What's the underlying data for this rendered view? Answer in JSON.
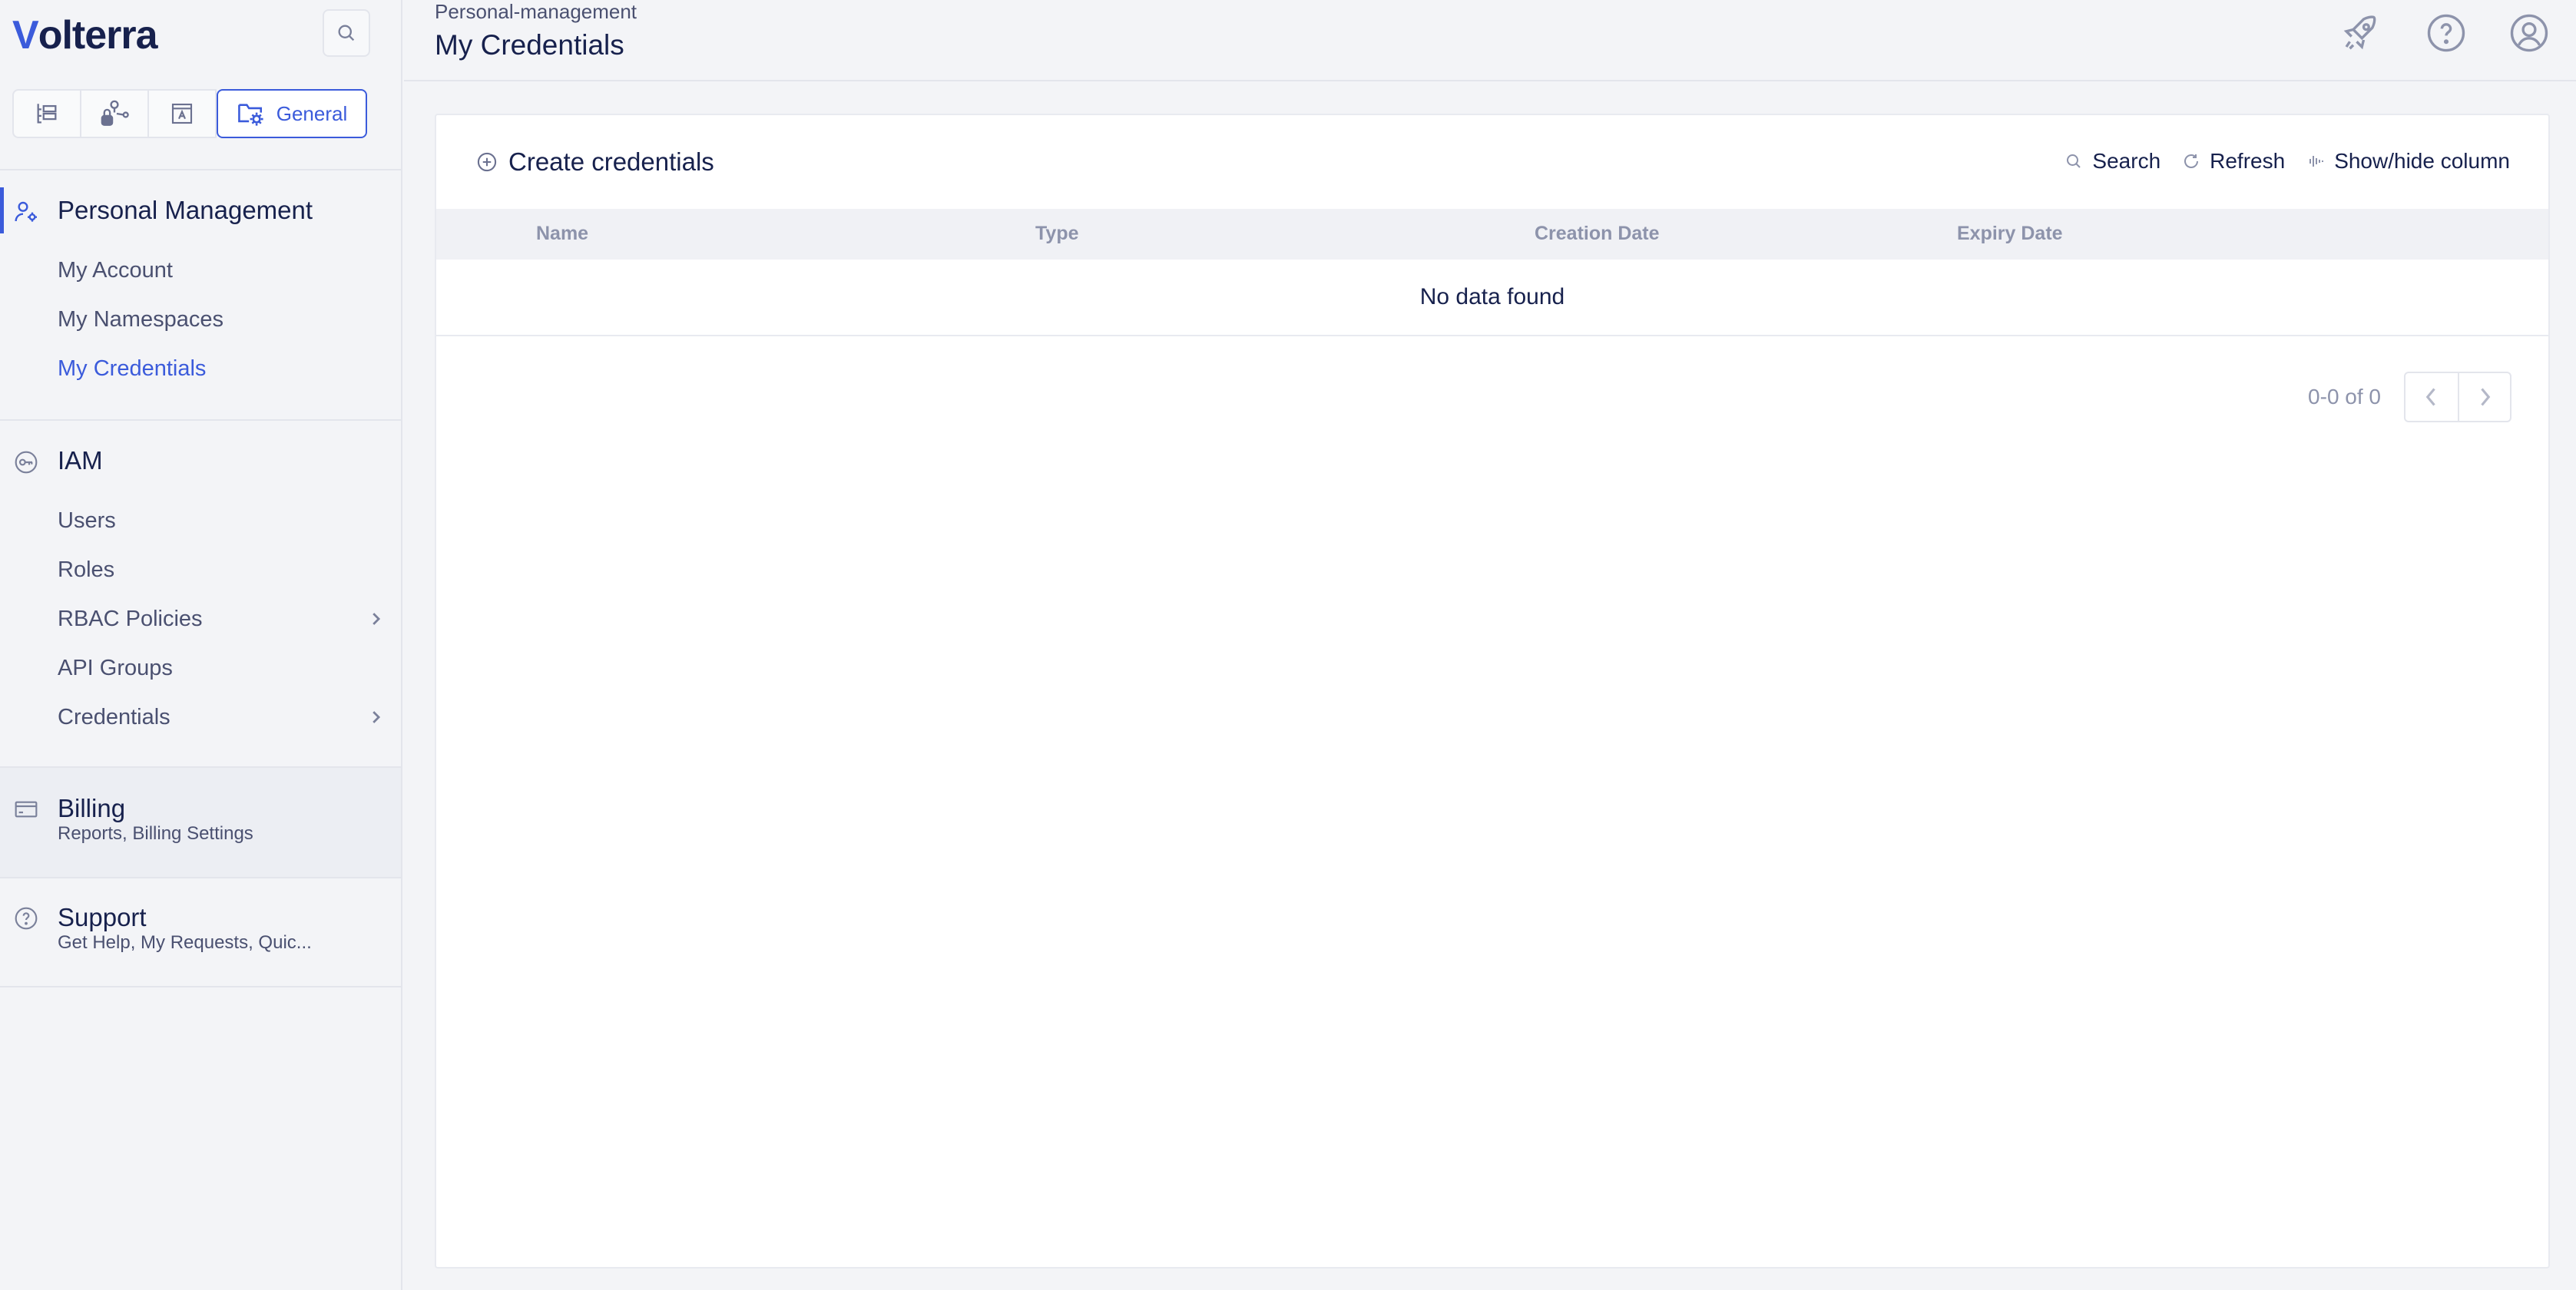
{
  "app": {
    "logo_text_v": "V",
    "logo_text_rest": "olterra"
  },
  "sidebar": {
    "tabs": [
      {
        "icon": "hierarchy-icon"
      },
      {
        "icon": "network-lock-icon"
      },
      {
        "icon": "app-window-icon"
      },
      {
        "icon": "folder-gear-icon",
        "label": "General"
      }
    ],
    "personal_management": {
      "title": "Personal Management",
      "items": [
        "My Account",
        "My Namespaces",
        "My Credentials"
      ],
      "selected": "My Credentials"
    },
    "iam": {
      "title": "IAM",
      "items": [
        "Users",
        "Roles",
        "RBAC Policies",
        "API Groups",
        "Credentials"
      ]
    },
    "billing": {
      "title": "Billing",
      "subtitle": "Reports, Billing Settings"
    },
    "support": {
      "title": "Support",
      "subtitle": "Get Help, My Requests, Quic..."
    }
  },
  "header": {
    "breadcrumb": "Personal-management",
    "title": "My Credentials"
  },
  "toolbar": {
    "create_label": "Create credentials",
    "search_label": "Search",
    "refresh_label": "Refresh",
    "columns_label": "Show/hide column"
  },
  "table": {
    "columns": [
      "Name",
      "Type",
      "Creation Date",
      "Expiry Date"
    ],
    "empty_message": "No data found"
  },
  "pagination": {
    "range_text": "0-0 of 0"
  },
  "colors": {
    "accent": "#3b5bdb",
    "text": "#17214d",
    "muted": "#8d93ab"
  }
}
